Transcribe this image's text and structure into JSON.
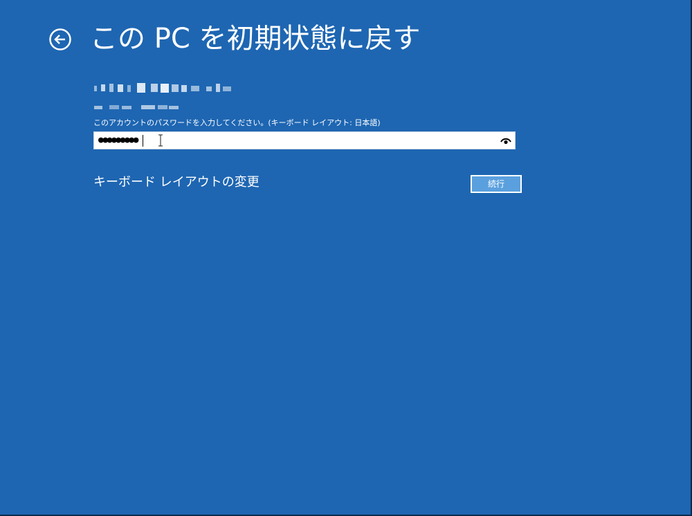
{
  "page": {
    "title": "この PC を初期状態に戻す",
    "background_color": "#1e66b2"
  },
  "back_button": {
    "icon": "back-arrow-icon"
  },
  "account": {
    "name_obscured": true,
    "email_obscured": true
  },
  "password": {
    "prompt": "このアカウントのパスワードを入力してください。(キーボード レイアウト: 日本語)",
    "masked_value": "●●●●●●●●●",
    "reveal_icon": "eye-icon"
  },
  "keyboard_layout_link": "キーボード レイアウトの変更",
  "continue_button": {
    "label": "続行",
    "fill_color": "#5aa0de"
  }
}
